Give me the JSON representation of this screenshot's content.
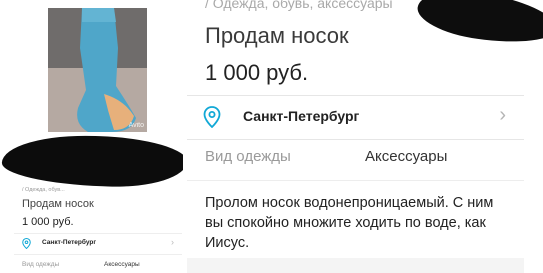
{
  "left": {
    "watermark": "Avito",
    "breadcrumb": "/ Одежда, обув...",
    "title": "Продам носок",
    "price": "1 000 руб.",
    "city": "Санкт-Петербург",
    "chevron": "›",
    "type_label": "Вид одежды",
    "type_value": "Аксессуары"
  },
  "right": {
    "breadcrumb": "/ Одежда, обувь, аксессуары",
    "title": "Продам носок",
    "price": "1 000 руб.",
    "city": "Санкт-Петербург",
    "chevron": "›",
    "type_label": "Вид одежды",
    "type_value": "Аксессуары",
    "description": "Пролом носок водонепроницаемый. С ним вы спокойно множите ходить по воде, как Иисус."
  },
  "colors": {
    "accent": "#11a8d6",
    "redaction": "#0c0c0c"
  },
  "icons": {
    "location": "location-pin-icon",
    "chevron": "chevron-right-icon"
  }
}
